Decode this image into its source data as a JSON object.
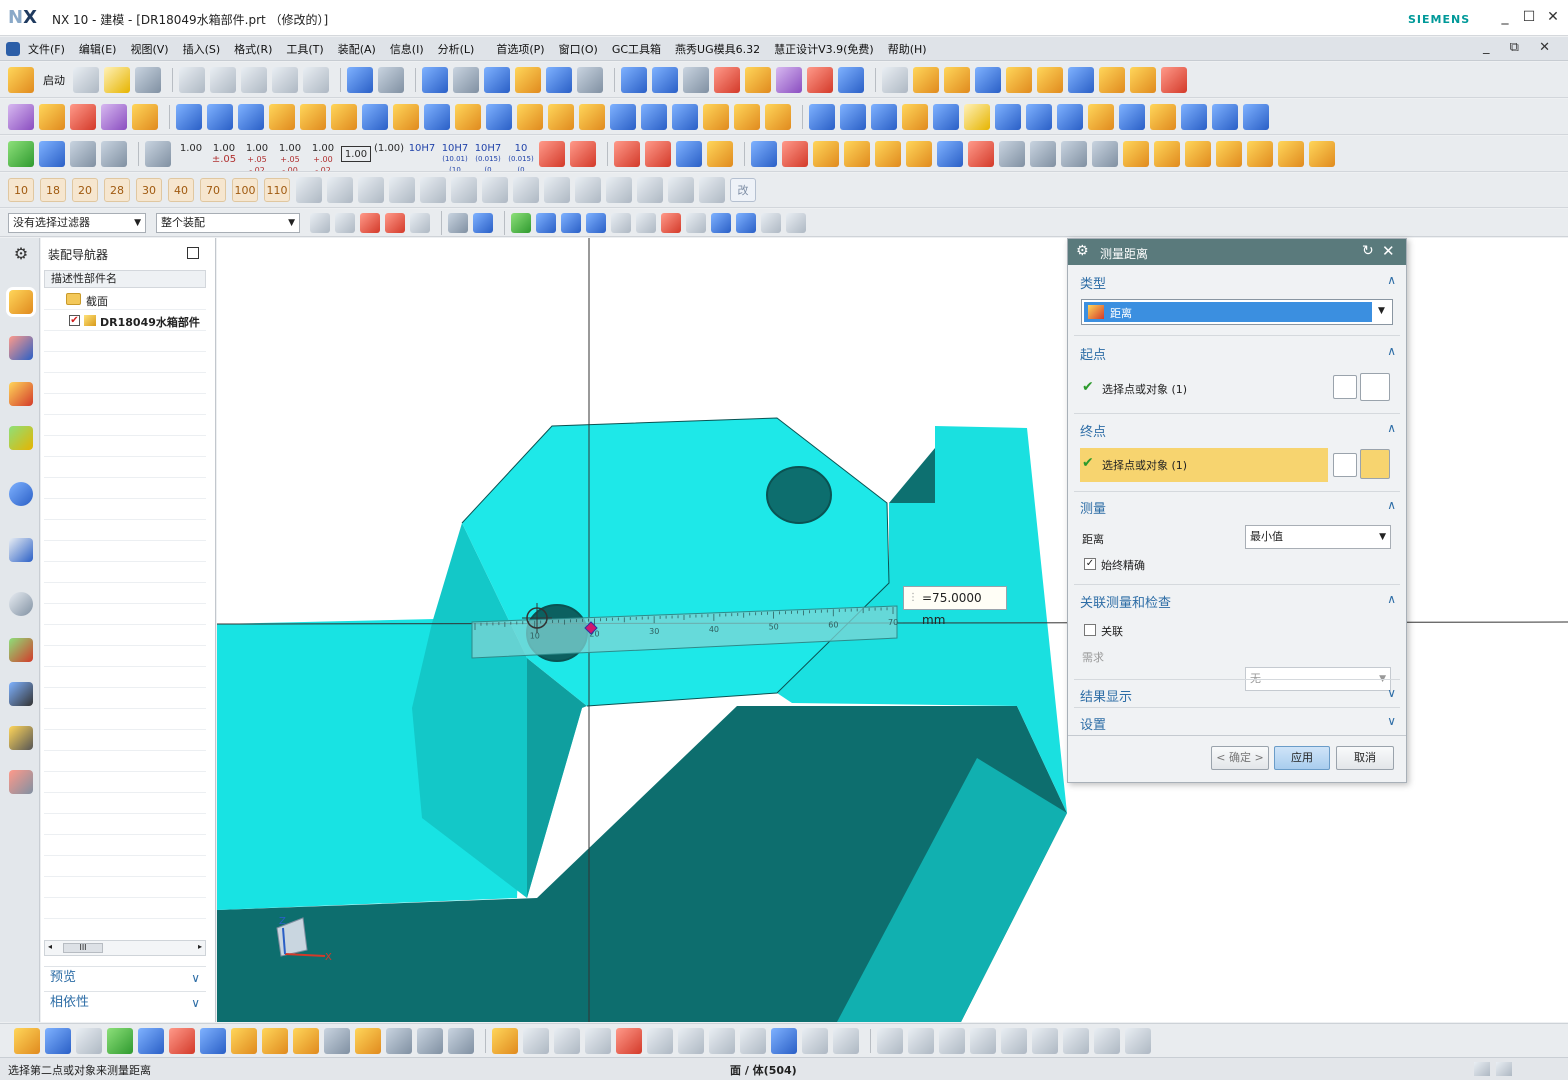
{
  "window": {
    "logo_a": "N",
    "logo_b": "X",
    "title": "NX 10 - 建模 - [DR18049水箱部件.prt （修改的）]",
    "brand": "SIEMENS",
    "min": "_",
    "max": "☐",
    "close": "✕"
  },
  "menu": {
    "items": [
      "文件(F)",
      "编辑(E)",
      "视图(V)",
      "插入(S)",
      "格式(R)",
      "工具(T)",
      "装配(A)",
      "信息(I)",
      "分析(L)",
      "首选项(P)",
      "窗口(O)",
      "GC工具箱",
      "燕秀UG模具6.32",
      "慧正设计V3.9(免费)",
      "帮助(H)"
    ],
    "right_controls": "_ ⧉ ✕"
  },
  "toolbar1": {
    "start_label": "启动",
    "more": "»"
  },
  "toolbar3": {
    "tolerances": [
      {
        "top": "1.00",
        "bot": ""
      },
      {
        "top": "1.00",
        "bot": "±.05"
      },
      {
        "top": "1.00",
        "bot": "+.05 -.02"
      },
      {
        "top": "1.00",
        "bot": "+.05 -.00"
      },
      {
        "top": "1.00",
        "bot": "+.00 -.02"
      },
      {
        "top": "1.00",
        "bot": ""
      },
      {
        "top": "(1.00)",
        "bot": ""
      },
      {
        "top": "10H7",
        "bot": ""
      },
      {
        "top": "10H7",
        "bot": "(10.01) (10"
      },
      {
        "top": "10H7",
        "bot": "(0.015) (0"
      },
      {
        "top": "10",
        "bot": "(0.015) (0"
      }
    ]
  },
  "toolbar4": {
    "numbers": [
      "10",
      "18",
      "20",
      "28",
      "30",
      "40",
      "70",
      "100",
      "110"
    ],
    "edit_label": "改"
  },
  "filterbar": {
    "filter": "没有选择过滤器",
    "scope": "整个装配"
  },
  "navigator": {
    "title": "装配导航器",
    "column": "描述性部件名",
    "items": [
      {
        "label": "截面"
      },
      {
        "label": "DR18049水箱部件"
      }
    ],
    "scroll_thumb": "III",
    "sections": [
      "预览",
      "相依性"
    ]
  },
  "viewport": {
    "measure_value": "=75.0000 mm",
    "ruler_ticks": [
      "10",
      "20",
      "30",
      "40",
      "50",
      "60",
      "70"
    ],
    "axis_x": "X",
    "axis_z": "Z"
  },
  "dialog": {
    "title": "测量距离",
    "sections": {
      "type": {
        "title": "类型",
        "value": "距离"
      },
      "start": {
        "title": "起点",
        "select": "选择点或对象 (1)"
      },
      "end": {
        "title": "终点",
        "select": "选择点或对象 (1)"
      },
      "measure": {
        "title": "测量",
        "distance_label": "距离",
        "distance_value": "最小值",
        "accurate_label": "始终精确"
      },
      "assoc": {
        "title": "关联测量和检查",
        "assoc_label": "关联",
        "req_label": "需求",
        "req_value": "无"
      },
      "result": {
        "title": "结果显示"
      },
      "settings": {
        "title": "设置"
      }
    },
    "buttons": {
      "ok": "< 确定 >",
      "apply": "应用",
      "cancel": "取消"
    }
  },
  "status": {
    "prompt": "选择第二点或对象来测量距离",
    "selection": "面 / 体(504)"
  },
  "colors": {
    "accent": "#2d6da6",
    "part": "#1ee8e8",
    "part_dark": "#0d7070",
    "dialog_header": "#5a7a7c",
    "highlight": "#f7d46f"
  }
}
